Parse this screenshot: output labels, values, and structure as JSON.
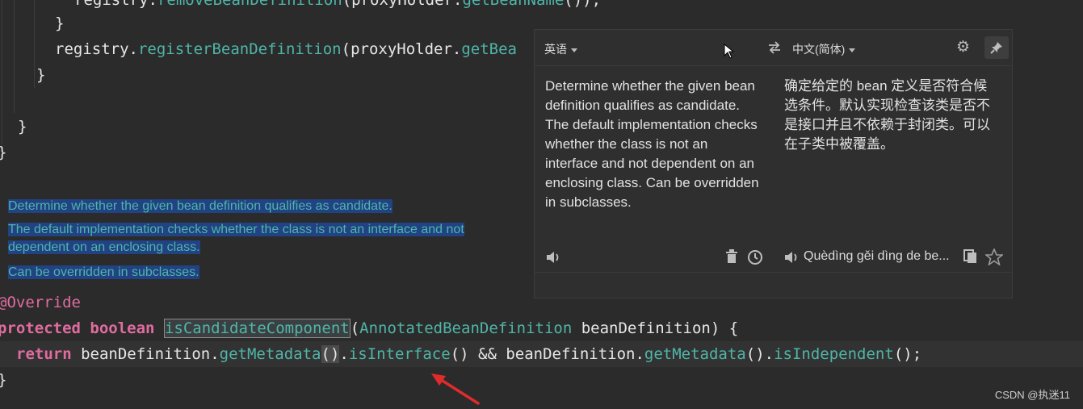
{
  "editor": {
    "line0": {
      "a": "registry.",
      "b": "removeBeanDefinition",
      "c": "(proxyHolder.",
      "d": "getBeanName",
      "e": "());"
    },
    "line1": "}",
    "line2": {
      "a": "registry.",
      "b": "registerBeanDefinition",
      "c": "(proxyHolder.",
      "d": "getBea"
    },
    "line3": "}",
    "line4": "}",
    "line5": "}",
    "doc": {
      "p1": "Determine whether the given bean definition qualifies as candidate.",
      "p2a": "The default implementation checks whether the class is not an interface and not",
      "p2b": "dependent on an enclosing class.",
      "p3": "Can be overridden in subclasses."
    },
    "annotation": "@Override",
    "sig": {
      "kw1": "protected",
      "kw2": "boolean",
      "name": "isCandidateComponent",
      "open": "(",
      "type": "AnnotatedBeanDefinition",
      "param": " beanDefinition",
      "close": ") {"
    },
    "ret": {
      "kw": "return",
      "a": " beanDefinition.",
      "b": "getMetadata",
      "c": "()",
      "d": ".",
      "e": "isInterface",
      "f": "() && beanDefinition.",
      "g": "getMetadata",
      "h": "().",
      "i": "isIndependent",
      "j": "();"
    },
    "closing": "}"
  },
  "popup": {
    "source_lang": "英语",
    "target_lang": "中文(简体)",
    "source_text": "Determine whether the given bean definition qualifies as candidate. The default implementation checks whether the class is not an interface and not dependent on an enclosing class. Can be overridden in subclasses.",
    "target_text": "确定给定的 bean 定义是否符合候选条件。默认实现检查该类是否不是接口并且不依赖于封闭类。可以在子类中被覆盖。",
    "romanized": "Quèdìng gěi dìng de be...",
    "icons": [
      "swap-icon",
      "gear-icon",
      "pin-icon",
      "speaker-icon",
      "trash-icon",
      "history-icon",
      "copy-icon",
      "star-icon"
    ]
  },
  "watermark": "CSDN @执迷11",
  "colors": {
    "background": "#2b2b2b",
    "keyword": "#e06c9f",
    "method": "#4fb5a8",
    "selection": "#214283",
    "arrow": "#e02b2b"
  }
}
